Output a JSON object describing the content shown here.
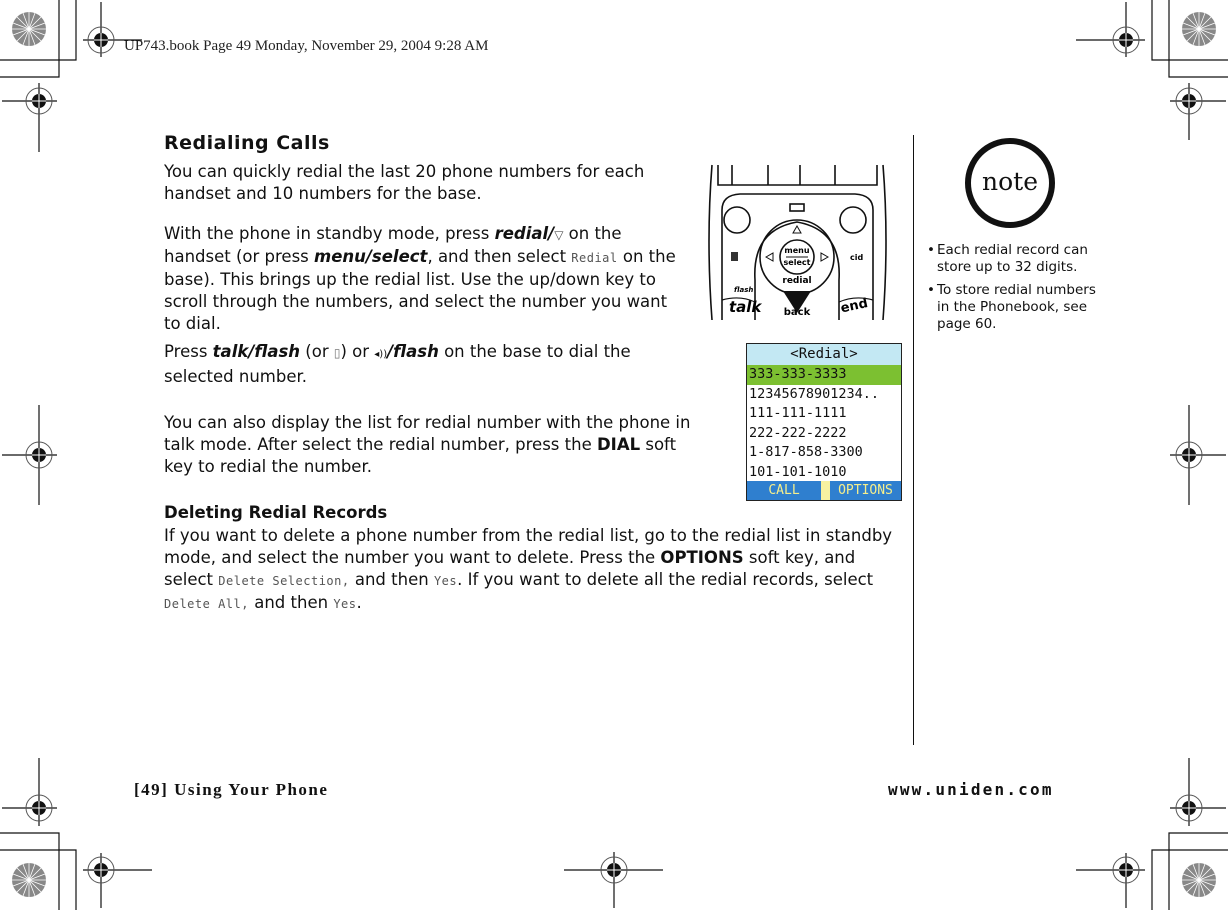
{
  "print_header": "UP743.book  Page 49  Monday, November 29, 2004  9:28 AM",
  "section": {
    "title": "Redialing Calls",
    "para1": "You can quickly redial the last 20 phone numbers for each handset and 10 numbers for the base.",
    "para2": {
      "t1": "With the phone in standby mode, press ",
      "key1": "redial/",
      "key1_icon": "▽",
      "t2": " on the handset (or press ",
      "key2": "menu/select",
      "t3": ", and then select ",
      "lcd1": "Redial",
      "t4": " on the base). This brings up the redial list. Use the up/down key to scroll through the numbers, and select the number you want to dial."
    },
    "para3": {
      "t1": "Press ",
      "key1": "talk/flash",
      "t2": " (or ",
      "icon1": "▯",
      "t3": ") or ",
      "icon2": "◂))",
      "key2": "/flash",
      "t4": " on the base to dial the selected number."
    },
    "para4": {
      "t1": "You can also display the list for redial number with the phone in talk mode. After select the redial number, press the ",
      "key1": "DIAL",
      "t2": " soft key to redial the number."
    }
  },
  "subsection": {
    "title": "Deleting Redial Records",
    "para": {
      "t1": "If you want to delete a phone number from the redial list, go to the redial list in standby mode, and select the number you want to delete. Press the ",
      "key1": "OPTIONS",
      "t2": " soft key, and select ",
      "lcd1": "Delete Selection,",
      "t3": " and then ",
      "lcd2": "Yes",
      "t4": ". If you want to delete all the redial records, select ",
      "lcd3": "Delete All,",
      "t5": " and then ",
      "lcd4": "Yes",
      "t6": "."
    }
  },
  "phone_keys": {
    "menu": "menu",
    "select": "select",
    "redial": "redial",
    "cid": "cid",
    "flash": "flash",
    "talk": "talk",
    "back": "back",
    "end": "end"
  },
  "lcd_screen": {
    "title": "<Redial>",
    "rows": [
      "333-333-3333",
      "12345678901234..",
      "111-111-1111",
      "222-222-2222",
      "1-817-858-3300",
      "101-101-1010"
    ],
    "selected_index": 0,
    "soft_left": "CALL",
    "soft_right": "OPTIONS",
    "colors": {
      "title_bg": "#c3e8f3",
      "selected_bg": "#7cc031",
      "softkey_bg": "#2f7fcf",
      "softkey_text": "#f5ee8c"
    }
  },
  "note": {
    "label": "note",
    "items": [
      "Each redial record can store up to 32 digits.",
      "To store redial numbers in the Phonebook, see page 60."
    ]
  },
  "footer": {
    "left": "[49] Using Your Phone",
    "right": "www.uniden.com"
  }
}
